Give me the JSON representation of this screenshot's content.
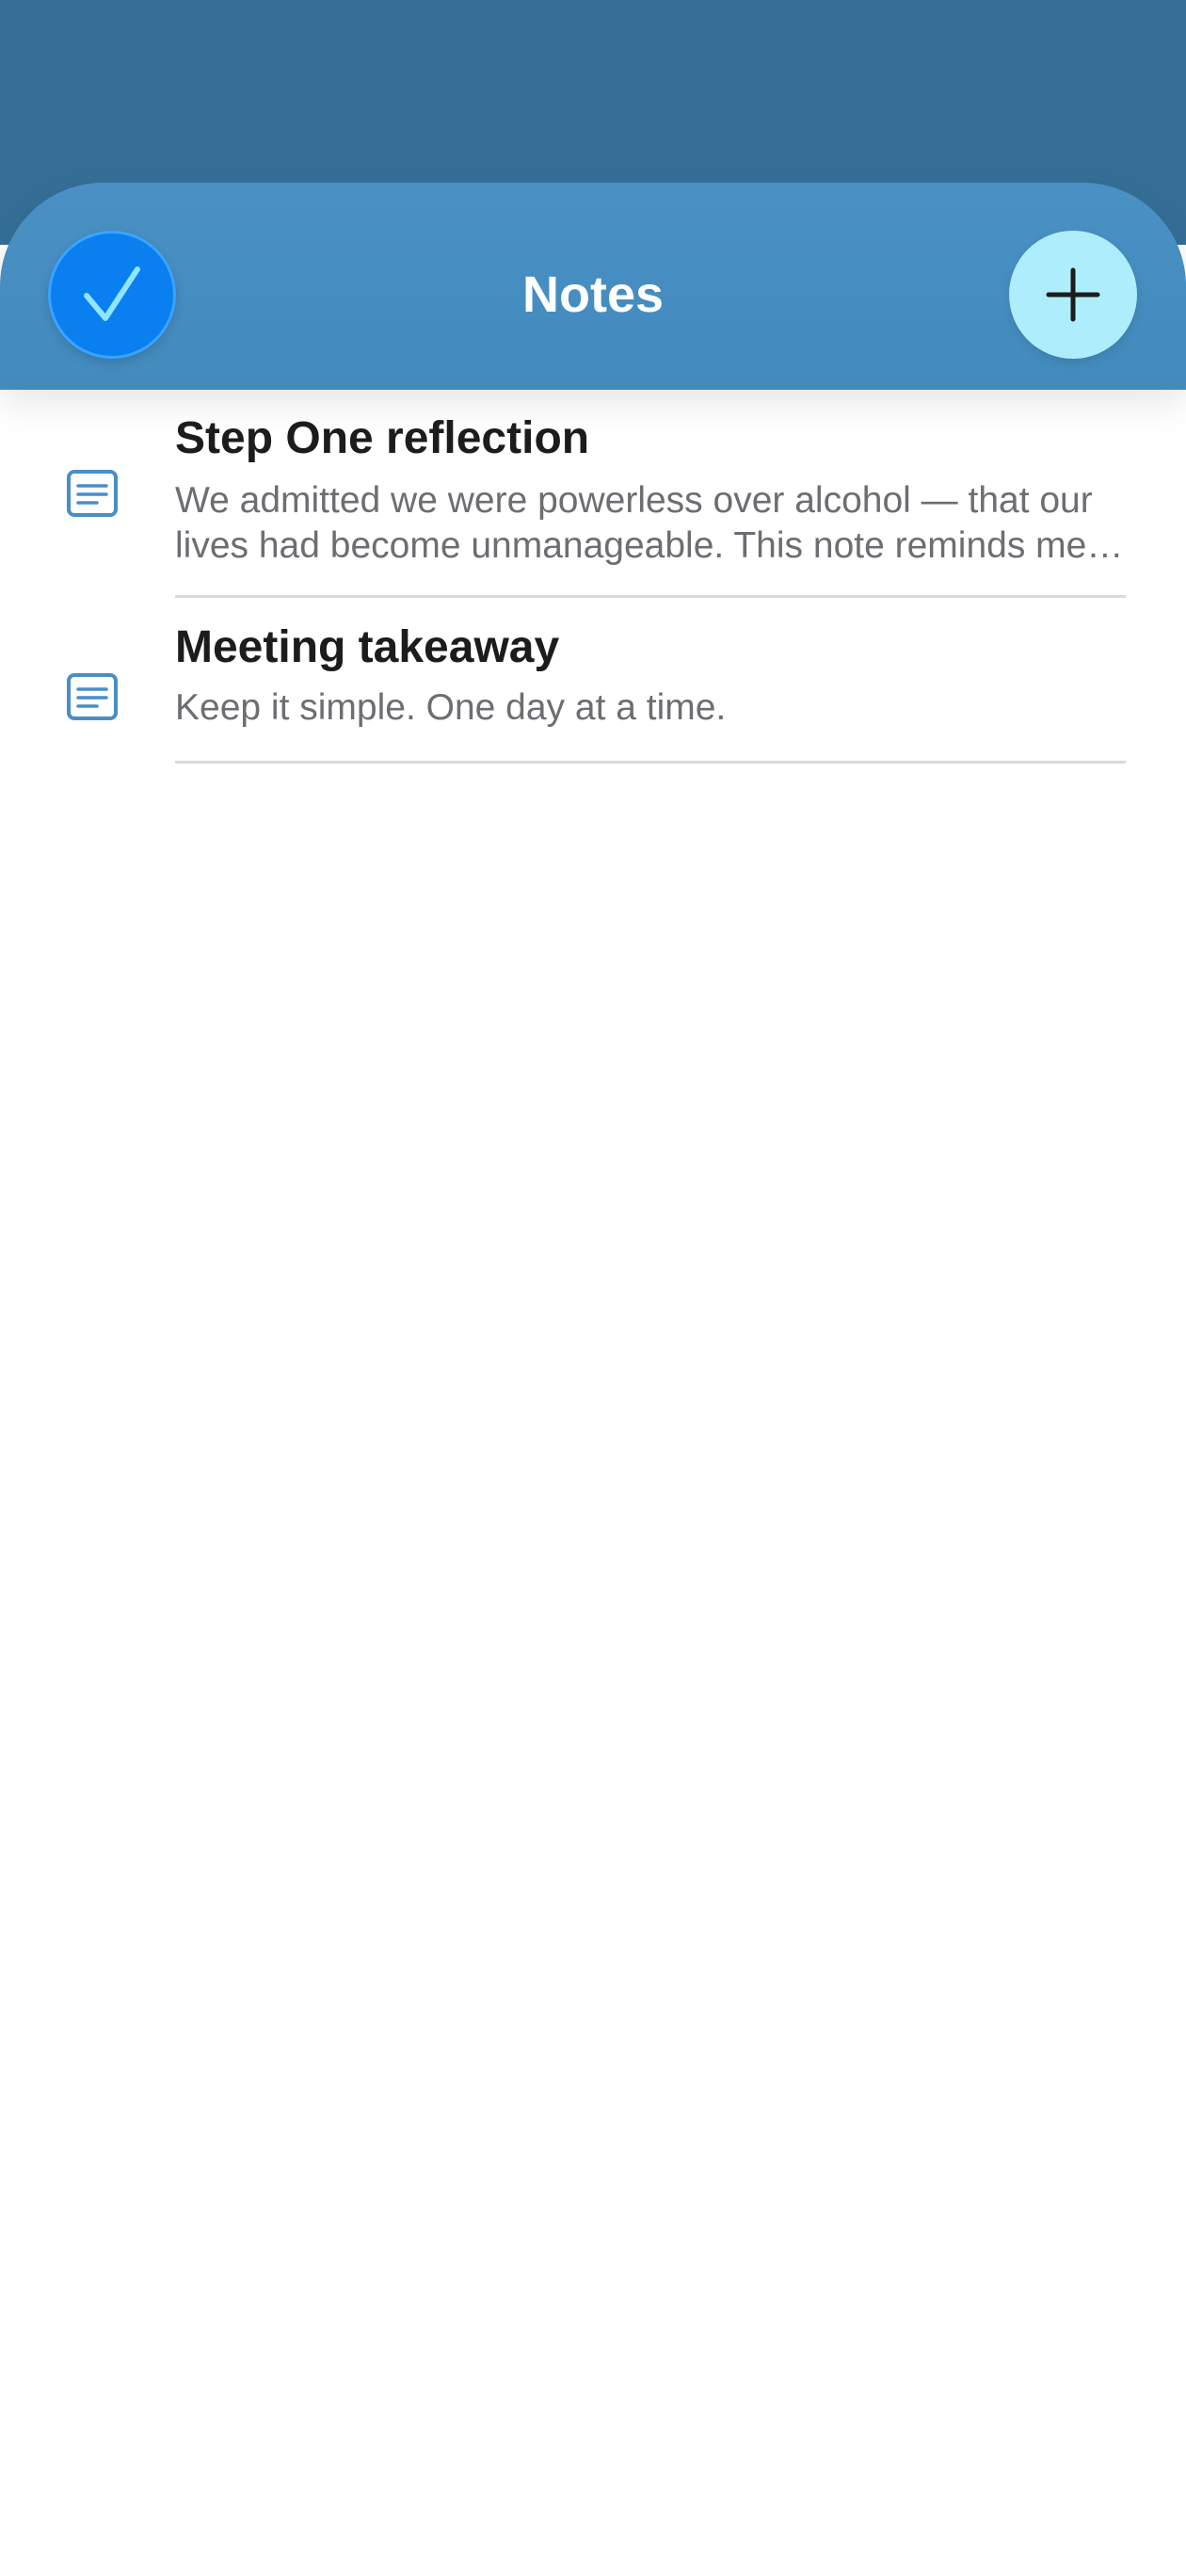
{
  "header": {
    "title": "Notes"
  },
  "notes": [
    {
      "title": "Step One reflection",
      "body": "We admitted we were powerless over alcohol — that our lives had become unmanageable. This note reminds me where I started."
    },
    {
      "title": "Meeting takeaway",
      "body": "Keep it simple. One day at a time."
    }
  ],
  "icons": {
    "done": "checkmark-icon",
    "add": "plus-icon",
    "note": "note-icon"
  },
  "colors": {
    "status_band": "#356f97",
    "nav_bar": "#4a90c4",
    "done_button": "#0a7ff0",
    "add_button": "#aeeefc",
    "note_icon": "#4a8ec6"
  }
}
